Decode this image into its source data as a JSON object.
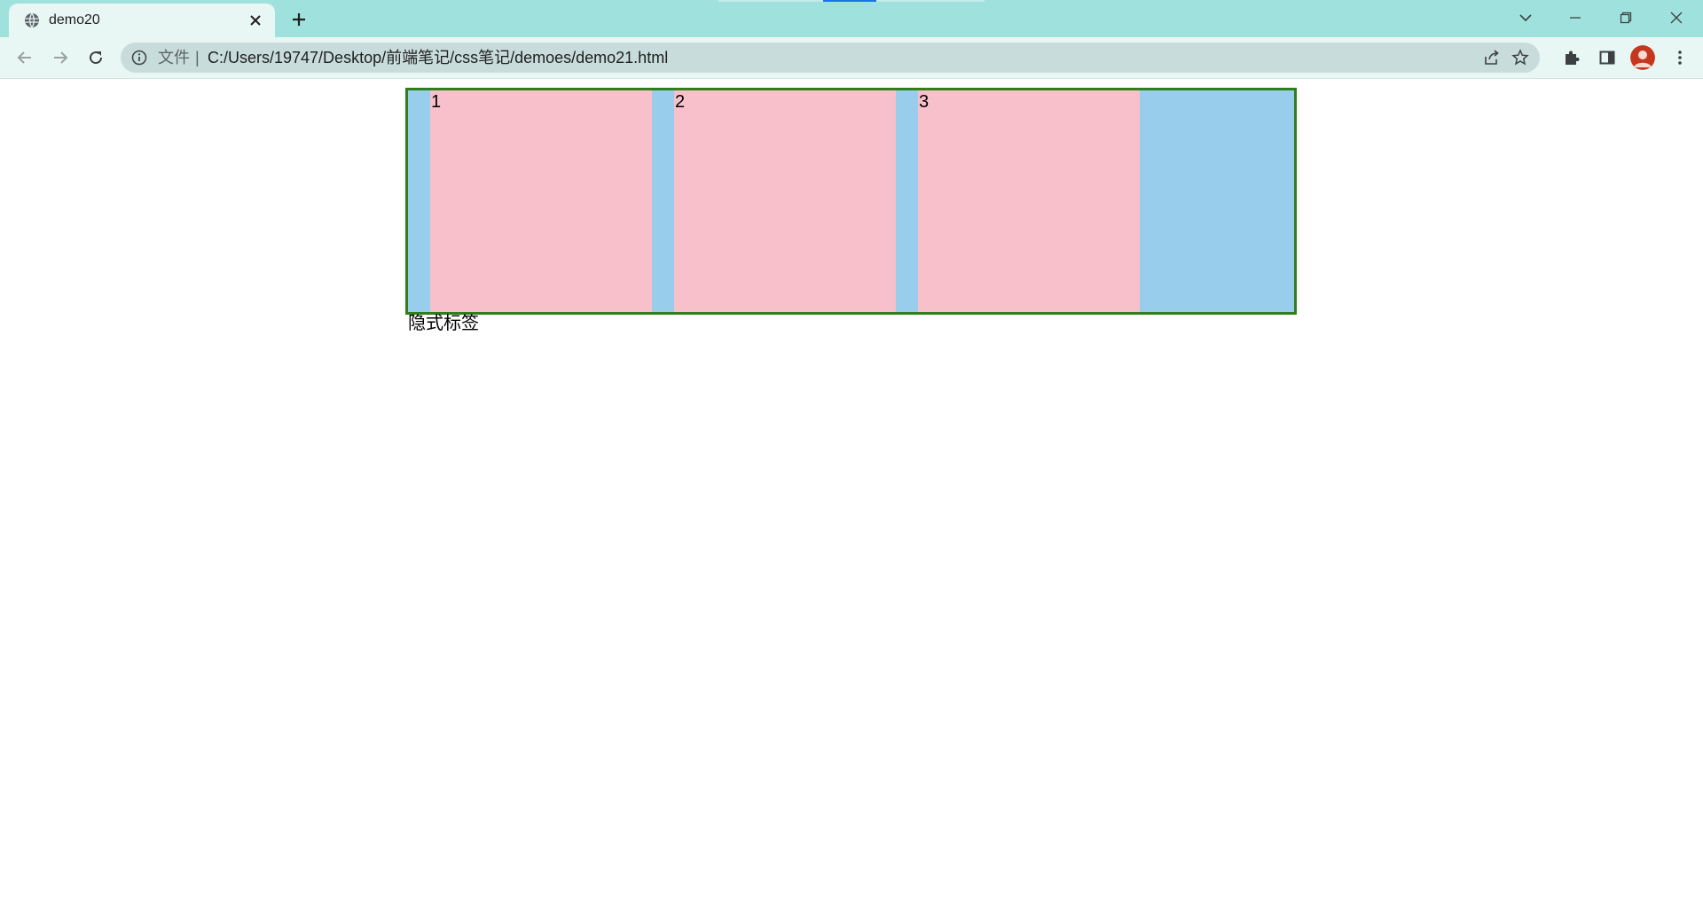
{
  "browser": {
    "tab": {
      "title": "demo20",
      "favicon": "globe-icon"
    },
    "colors": {
      "tabstrip_bg": "#9fe2dd",
      "toolbar_bg": "#e8f6f4",
      "omnibox_bg": "#c8dcdb",
      "strip_indicator": "#1a73e8"
    },
    "address_bar": {
      "security_label": "文件",
      "separator": "|",
      "url": "C:/Users/19747/Desktop/前端笔记/css笔记/demoes/demo21.html"
    },
    "icons": {
      "back": "arrow-left-icon",
      "forward": "arrow-right-icon",
      "reload": "reload-icon",
      "share": "share-icon",
      "bookmark": "star-icon",
      "extensions": "puzzle-icon",
      "side_panel": "side-panel-icon",
      "menu": "more-vertical-icon",
      "minimize": "minimize-icon",
      "restore": "restore-icon",
      "close": "close-icon",
      "tab_search": "chevron-down-icon"
    }
  },
  "page": {
    "container_colors": {
      "border": "#2f7d1b",
      "background": "#98ceeb",
      "item": "#f7c0ca"
    },
    "items": [
      {
        "label": "1"
      },
      {
        "label": "2"
      },
      {
        "label": "3"
      }
    ],
    "caption": "隐式标签"
  }
}
